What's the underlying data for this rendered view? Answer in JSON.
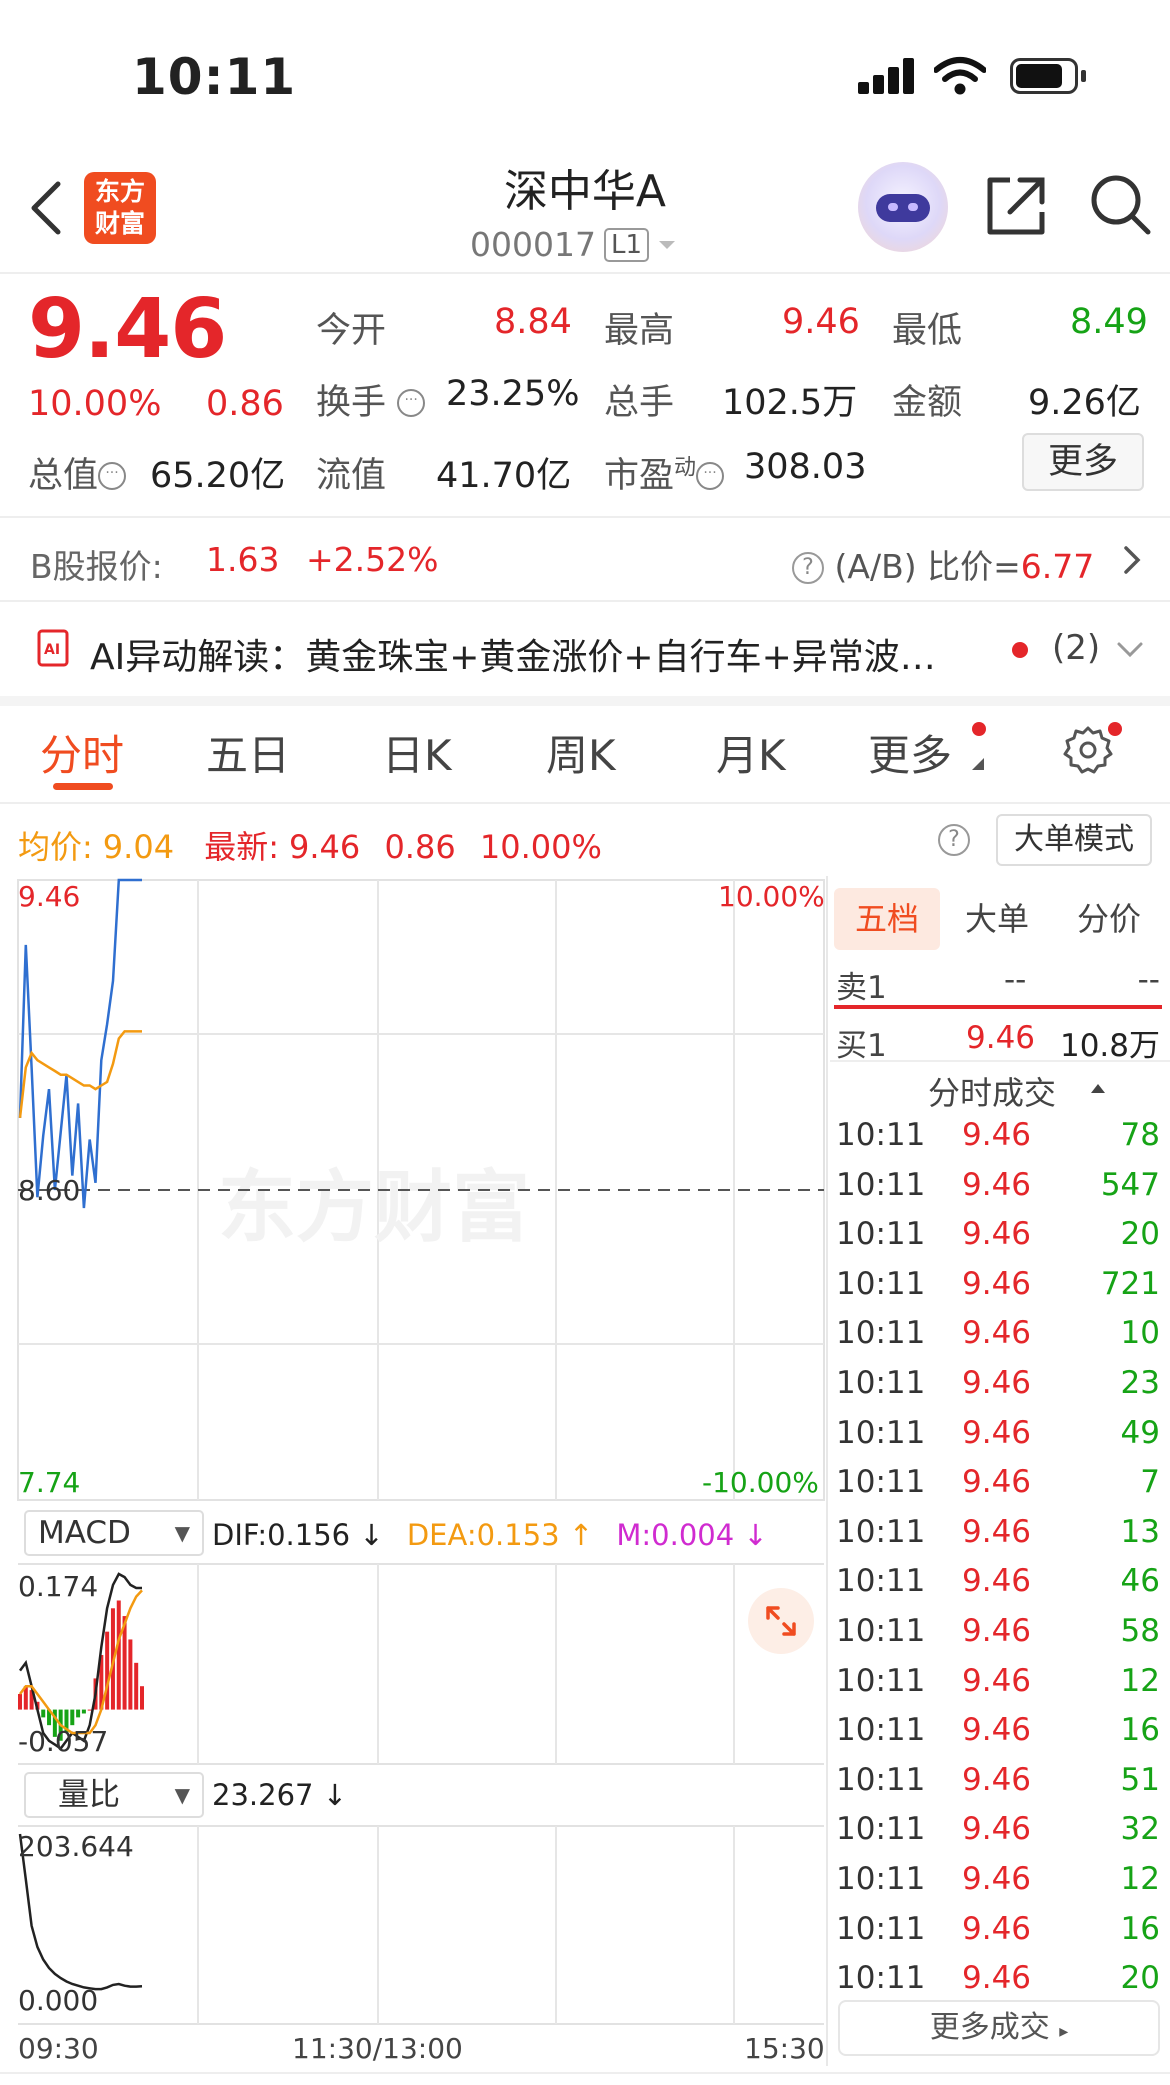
{
  "status_bar": {
    "time": "10:11"
  },
  "header": {
    "logo_line1": "东方",
    "logo_line2": "财富",
    "stock_name": "深中华A",
    "stock_code": "000017",
    "level_badge": "L1"
  },
  "quote": {
    "price": "9.46",
    "change_pct": "10.00%",
    "change_amt": "0.86",
    "cells": {
      "open_label": "今开",
      "open_value": "8.84",
      "high_label": "最高",
      "high_value": "9.46",
      "low_label": "最低",
      "low_value": "8.49",
      "turnover_label": "换手",
      "turnover_value": "23.25%",
      "volume_label": "总手",
      "volume_value": "102.5万",
      "amount_label": "金额",
      "amount_value": "9.26亿",
      "mktcap_label": "总值",
      "mktcap_value": "65.20亿",
      "float_label": "流值",
      "float_value": "41.70亿",
      "pe_label": "市盈",
      "pe_sup": "动",
      "pe_value": "308.03"
    },
    "more_button": "更多"
  },
  "b_share": {
    "label": "B股报价:",
    "price": "1.63",
    "change": "+2.52%",
    "ratio_label": "(A/B) 比价=",
    "ratio_value": "6.77"
  },
  "ai_banner": {
    "text": "AI异动解读：黄金珠宝+黄金涨价+自行车+异常波…",
    "count": "(2)"
  },
  "tabs": [
    "分时",
    "五日",
    "日K",
    "周K",
    "月K",
    "更多"
  ],
  "chart_header": {
    "avg_label": "均价:",
    "avg_value": "9.04",
    "latest_label": "最新:",
    "latest_value": "9.46",
    "latest_change": "0.86",
    "latest_pct": "10.00%",
    "mode_button": "大单模式"
  },
  "chart_data": [
    {
      "type": "line",
      "title": "",
      "y_left_ticks": [
        "9.46",
        "8.60",
        "7.74"
      ],
      "y_right_ticks": [
        "10.00%",
        "-10.00%"
      ],
      "x_ticks": [
        "09:30",
        "11:30/13:00",
        "15:30"
      ],
      "ylim": [
        7.74,
        9.46
      ],
      "series": [
        {
          "name": "最新",
          "color": "#2f6fd0",
          "values": [
            8.8,
            9.28,
            8.94,
            8.58,
            8.75,
            8.88,
            8.6,
            8.76,
            8.92,
            8.64,
            8.84,
            8.55,
            8.74,
            8.62,
            8.96,
            9.06,
            9.18,
            9.46,
            9.46,
            9.46,
            9.46,
            9.46
          ]
        },
        {
          "name": "均价",
          "color": "#f39a11",
          "values": [
            8.8,
            8.94,
            8.98,
            8.96,
            8.95,
            8.94,
            8.93,
            8.92,
            8.92,
            8.91,
            8.9,
            8.89,
            8.89,
            8.88,
            8.89,
            8.9,
            8.95,
            9.02,
            9.04,
            9.04,
            9.04,
            9.04
          ]
        }
      ],
      "baseline": 8.6
    },
    {
      "type": "bar",
      "title": "MACD",
      "y_ticks": [
        "0.174",
        "-0.057"
      ],
      "ylim": [
        -0.057,
        0.174
      ],
      "legend": {
        "dif": "DIF:0.156 ↓",
        "dea": "DEA:0.153 ↑",
        "m": "M:0.004 ↓"
      },
      "values": [
        0.02,
        0.03,
        0.025,
        0.01,
        -0.01,
        -0.02,
        -0.035,
        -0.04,
        -0.03,
        -0.02,
        -0.01,
        -0.005,
        0.0,
        0.04,
        0.07,
        0.1,
        0.13,
        0.14,
        0.12,
        0.09,
        0.06,
        0.03
      ],
      "dif": [
        0.05,
        0.06,
        0.03,
        0.0,
        -0.03,
        -0.04,
        -0.045,
        -0.05,
        -0.04,
        -0.03,
        -0.035,
        -0.04,
        -0.02,
        0.02,
        0.08,
        0.13,
        0.16,
        0.174,
        0.17,
        0.16,
        0.156,
        0.156
      ],
      "dea": [
        0.02,
        0.03,
        0.03,
        0.02,
        0.01,
        0.0,
        -0.01,
        -0.02,
        -0.025,
        -0.03,
        -0.03,
        -0.03,
        -0.03,
        -0.02,
        0.0,
        0.03,
        0.06,
        0.09,
        0.11,
        0.13,
        0.145,
        0.153
      ]
    },
    {
      "type": "line",
      "title": "量比",
      "legend": "23.267 ↓",
      "y_ticks": [
        "203.644",
        "0.000"
      ],
      "ylim": [
        0,
        203.644
      ],
      "values": [
        203.6,
        150,
        95,
        70,
        55,
        45,
        38,
        33,
        29,
        26,
        24,
        22,
        21,
        20,
        20,
        22,
        25,
        26,
        24,
        23,
        23,
        23.3
      ]
    }
  ],
  "right_panel": {
    "tabs": [
      "五档",
      "大单",
      "分价"
    ],
    "sell1_label": "卖1",
    "sell1_price": "--",
    "sell1_vol": "--",
    "buy1_label": "买1",
    "buy1_price": "9.46",
    "buy1_vol": "10.8万",
    "trades_title": "分时成交",
    "trades": [
      {
        "t": "10:11",
        "p": "9.46",
        "v": "78"
      },
      {
        "t": "10:11",
        "p": "9.46",
        "v": "547"
      },
      {
        "t": "10:11",
        "p": "9.46",
        "v": "20"
      },
      {
        "t": "10:11",
        "p": "9.46",
        "v": "721"
      },
      {
        "t": "10:11",
        "p": "9.46",
        "v": "10"
      },
      {
        "t": "10:11",
        "p": "9.46",
        "v": "23"
      },
      {
        "t": "10:11",
        "p": "9.46",
        "v": "49"
      },
      {
        "t": "10:11",
        "p": "9.46",
        "v": "7"
      },
      {
        "t": "10:11",
        "p": "9.46",
        "v": "13"
      },
      {
        "t": "10:11",
        "p": "9.46",
        "v": "46"
      },
      {
        "t": "10:11",
        "p": "9.46",
        "v": "58"
      },
      {
        "t": "10:11",
        "p": "9.46",
        "v": "12"
      },
      {
        "t": "10:11",
        "p": "9.46",
        "v": "16"
      },
      {
        "t": "10:11",
        "p": "9.46",
        "v": "51"
      },
      {
        "t": "10:11",
        "p": "9.46",
        "v": "32"
      },
      {
        "t": "10:11",
        "p": "9.46",
        "v": "12"
      },
      {
        "t": "10:11",
        "p": "9.46",
        "v": "16"
      },
      {
        "t": "10:11",
        "p": "9.46",
        "v": "20"
      }
    ],
    "more_trades": "更多成交"
  },
  "colors": {
    "up": "#e4262a",
    "down": "#16a316",
    "accent": "#f04c20",
    "avg": "#f39a11",
    "price_line": "#2f6fd0",
    "m": "#d02bd0"
  }
}
